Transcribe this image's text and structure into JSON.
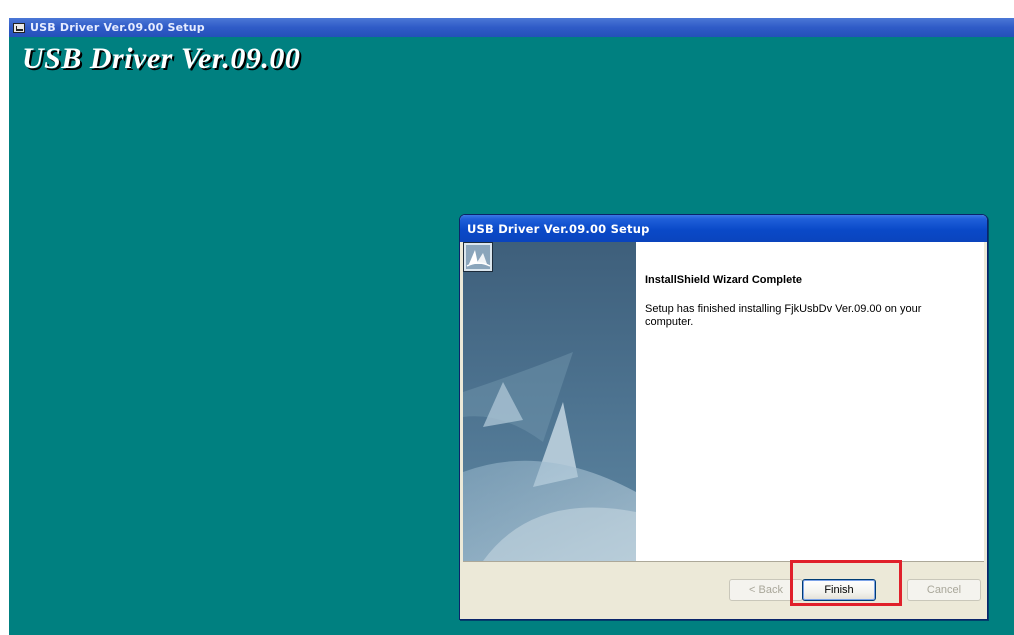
{
  "background_window": {
    "title": "USB Driver Ver.09.00 Setup",
    "banner": "USB Driver Ver.09.00"
  },
  "dialog": {
    "title": "USB Driver Ver.09.00 Setup",
    "heading": "InstallShield Wizard Complete",
    "message": "Setup has finished installing FjkUsbDv Ver.09.00 on your computer.",
    "buttons": {
      "back": "< Back",
      "finish": "Finish",
      "cancel": "Cancel"
    }
  },
  "colors": {
    "desktop_teal": "#008080",
    "title_blue": "#0a49c8",
    "highlight_red": "#e0202a"
  }
}
